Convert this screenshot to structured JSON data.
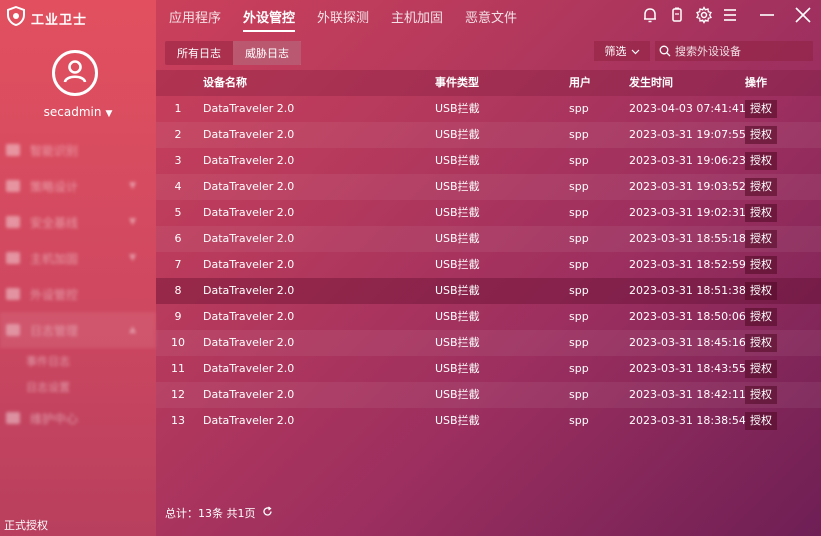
{
  "app": {
    "title": "工业卫士",
    "license": "正式授权"
  },
  "user": {
    "name": "secadmin"
  },
  "sidebar": {
    "items": [
      {
        "label": "智能识别"
      },
      {
        "label": "策略设计"
      },
      {
        "label": "安全基线"
      },
      {
        "label": "主机加固"
      },
      {
        "label": "外设管控"
      },
      {
        "label": "日志管理"
      }
    ],
    "subitems": [
      {
        "label": "事件日志"
      },
      {
        "label": "日志设置"
      }
    ],
    "last_item": {
      "label": "维护中心"
    }
  },
  "topnav": {
    "tabs": [
      {
        "label": "应用程序"
      },
      {
        "label": "外设管控"
      },
      {
        "label": "外联探测"
      },
      {
        "label": "主机加固"
      },
      {
        "label": "恶意文件"
      }
    ]
  },
  "toolbar": {
    "subtabs": [
      {
        "label": "所有日志"
      },
      {
        "label": "威胁日志"
      }
    ],
    "filter_label": "筛选",
    "search_placeholder": "搜索外设设备"
  },
  "table": {
    "headers": {
      "name": "设备名称",
      "type": "事件类型",
      "user": "用户",
      "time": "发生时间",
      "op": "操作"
    },
    "rows": [
      {
        "idx": "1",
        "name": "DataTraveler 2.0",
        "type": "USB拦截",
        "user": "spp",
        "time": "2023-04-03 07:41:41",
        "op": "授权"
      },
      {
        "idx": "2",
        "name": "DataTraveler 2.0",
        "type": "USB拦截",
        "user": "spp",
        "time": "2023-03-31 19:07:55",
        "op": "授权"
      },
      {
        "idx": "3",
        "name": "DataTraveler 2.0",
        "type": "USB拦截",
        "user": "spp",
        "time": "2023-03-31 19:06:23",
        "op": "授权"
      },
      {
        "idx": "4",
        "name": "DataTraveler 2.0",
        "type": "USB拦截",
        "user": "spp",
        "time": "2023-03-31 19:03:52",
        "op": "授权"
      },
      {
        "idx": "5",
        "name": "DataTraveler 2.0",
        "type": "USB拦截",
        "user": "spp",
        "time": "2023-03-31 19:02:31",
        "op": "授权"
      },
      {
        "idx": "6",
        "name": "DataTraveler 2.0",
        "type": "USB拦截",
        "user": "spp",
        "time": "2023-03-31 18:55:18",
        "op": "授权"
      },
      {
        "idx": "7",
        "name": "DataTraveler 2.0",
        "type": "USB拦截",
        "user": "spp",
        "time": "2023-03-31 18:52:59",
        "op": "授权"
      },
      {
        "idx": "8",
        "name": "DataTraveler 2.0",
        "type": "USB拦截",
        "user": "spp",
        "time": "2023-03-31 18:51:38",
        "op": "授权"
      },
      {
        "idx": "9",
        "name": "DataTraveler 2.0",
        "type": "USB拦截",
        "user": "spp",
        "time": "2023-03-31 18:50:06",
        "op": "授权"
      },
      {
        "idx": "10",
        "name": "DataTraveler 2.0",
        "type": "USB拦截",
        "user": "spp",
        "time": "2023-03-31 18:45:16",
        "op": "授权"
      },
      {
        "idx": "11",
        "name": "DataTraveler 2.0",
        "type": "USB拦截",
        "user": "spp",
        "time": "2023-03-31 18:43:55",
        "op": "授权"
      },
      {
        "idx": "12",
        "name": "DataTraveler 2.0",
        "type": "USB拦截",
        "user": "spp",
        "time": "2023-03-31 18:42:11",
        "op": "授权"
      },
      {
        "idx": "13",
        "name": "DataTraveler 2.0",
        "type": "USB拦截",
        "user": "spp",
        "time": "2023-03-31 18:38:54",
        "op": "授权"
      }
    ]
  },
  "footer": {
    "summary": "总计：13条 共1页"
  },
  "colors": {
    "accent_start": "#d4435a",
    "accent_end": "#6e1f55"
  }
}
